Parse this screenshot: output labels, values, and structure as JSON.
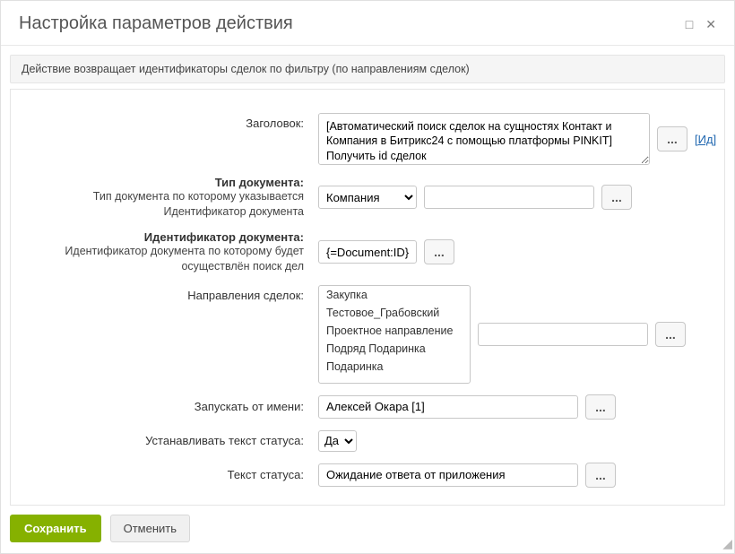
{
  "header": {
    "title": "Настройка параметров действия"
  },
  "description": "Действие возвращает идентификаторы сделок по фильтру (по направлениям сделок)",
  "labels": {
    "title": "Заголовок:",
    "docTypeBold": "Тип документа:",
    "docTypeSub": "Тип документа по которому указывается Идентификатор документа",
    "docIdBold": "Идентификатор документа:",
    "docIdSub": "Идентификатор документа по которому будет осуществлён поиск дел",
    "directions": "Направления сделок:",
    "runAs": "Запускать от имени:",
    "setStatus": "Устанавливать текст статуса:",
    "statusText": "Текст статуса:"
  },
  "values": {
    "title": "[Автоматический поиск сделок на сущностях Контакт и Компания в Битрикс24 с помощью платформы PINKIT] Получить id сделок",
    "docType": "Компания",
    "docTypeExtra": "",
    "docId": "{=Document:ID}",
    "directionsExtra": "",
    "runAs": "Алексей Окара [1]",
    "setStatus": "Да",
    "statusText": "Ожидание ответа от приложения"
  },
  "directions": [
    "Закупка",
    "Тестовое_Грабовский",
    "Проектное направление",
    "Подряд Подаринка",
    "Подаринка"
  ],
  "links": {
    "id": "[Ид]"
  },
  "buttons": {
    "dots": "...",
    "save": "Сохранить",
    "cancel": "Отменить"
  }
}
